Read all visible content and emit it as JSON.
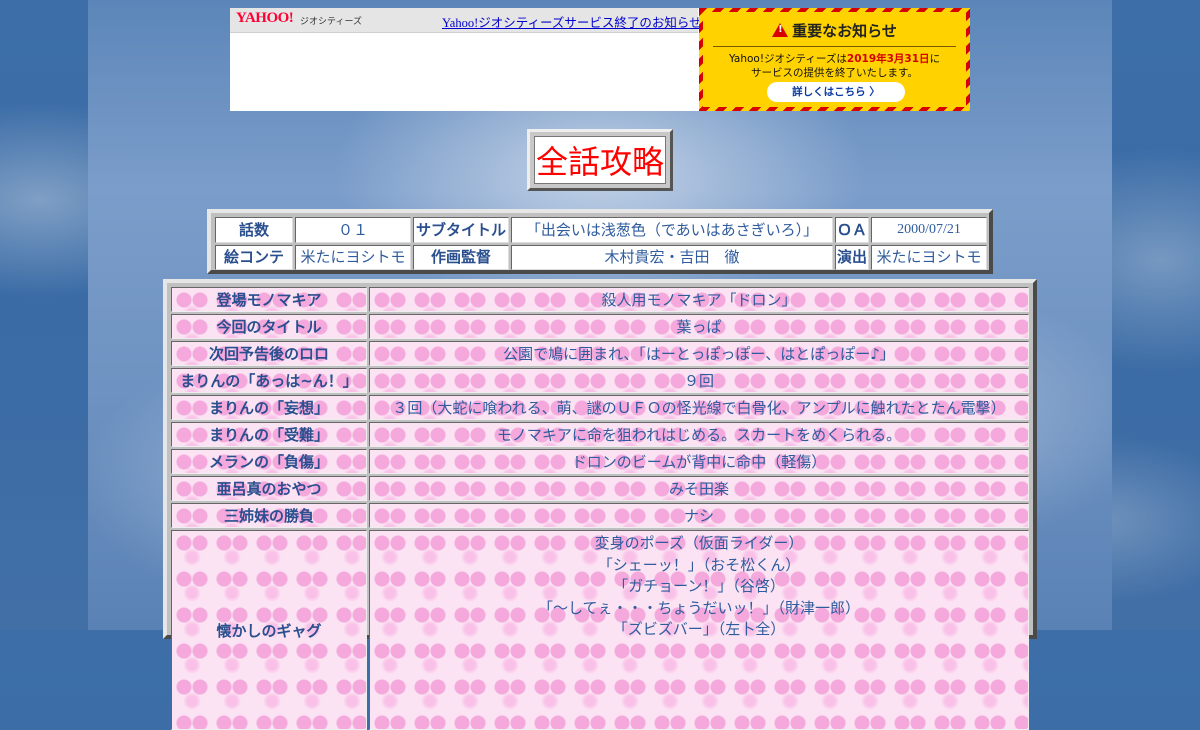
{
  "yahoo": {
    "logo": "YAHOO!",
    "logo_sub": "ジオシティーズ",
    "link": "Yahoo!ジオシティーズサービス終了のお知らせ",
    "notice_title": "重要なお知らせ",
    "notice_line1_a": "Yahoo!ジオシティーズは",
    "notice_line1_date": "2019年3月31日",
    "notice_line1_b": "に",
    "notice_line2": "サービスの提供を終了いたします。",
    "notice_button": "詳しくはこちら 〉"
  },
  "page_title": "全話攻略",
  "info": {
    "episode_label": "話数",
    "episode_value": "０１",
    "subtitle_label": "サブタイトル",
    "subtitle_value": "「出会いは浅葱色（であいはあさぎいろ）」",
    "oa_label": "ＯＡ",
    "oa_value": "2000/07/21",
    "storyboard_label": "絵コンテ",
    "storyboard_value": "米たにヨシトモ",
    "animation_director_label": "作画監督",
    "animation_director_value": "木村貴宏・吉田　徹",
    "director_label": "演出",
    "director_value": "米たにヨシトモ"
  },
  "rows": [
    {
      "label": "登場モノマキア",
      "value": "殺人用モノマキア「ドロン」"
    },
    {
      "label": "今回のタイトル",
      "value": "葉っぱ"
    },
    {
      "label": "次回予告後のロロ",
      "value": "公園で鳩に囲まれ、「はーとっぽっぽー、はとぽっぽー♪」"
    },
    {
      "label": "まりんの「あっは~ん！」",
      "value": "９回"
    },
    {
      "label": "まりんの「妄想」",
      "value": "３回（大蛇に喰われる、萌、謎のＵＦＯの怪光線で白骨化、アンプルに触れたとたん電撃）"
    },
    {
      "label": "まりんの「受難」",
      "value": "モノマキアに命を狙われはじめる。スカートをめくられる。"
    },
    {
      "label": "メランの「負傷」",
      "value": "ドロンのビームが背中に命中（軽傷）"
    },
    {
      "label": "亜呂真のおやつ",
      "value": "みそ田楽"
    },
    {
      "label": "三姉妹の勝負",
      "value": "ナシ"
    }
  ],
  "gags": {
    "label": "懐かしのギャグ",
    "items": [
      "変身のポーズ（仮面ライダー）",
      "「シェーッ！」（おそ松くん）",
      "「ガチョーン！」（谷啓）",
      "「～してぇ・・・ちょうだいッ！」（財津一郎）",
      "「ズビズバー」（左卜全）"
    ]
  },
  "colors": {
    "notice_bg": "#ffd200",
    "notice_red": "#d60000",
    "title_red": "#ff0000",
    "text_blue": "#2f5c9e",
    "cell_pink": "#fbe3f3"
  }
}
